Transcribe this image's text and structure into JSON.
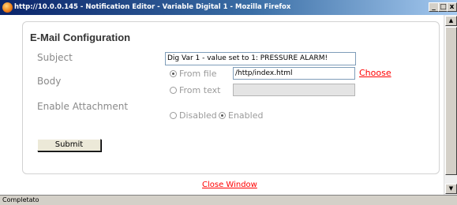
{
  "window": {
    "title": "http://10.0.0.145 - Notification Editor - Variable Digital 1 - Mozilla Firefox",
    "minimize_glyph": "_",
    "maximize_glyph": "□",
    "close_glyph": "x"
  },
  "form": {
    "section_title": "E-Mail Configuration",
    "subject_label": "Subject",
    "subject_value": "Dig Var 1 - value set to 1: PRESSURE ALARM!",
    "body_label": "Body",
    "from_file_label": "From file",
    "from_file_selected": true,
    "file_path_value": "/http/index.html",
    "choose_link": "Choose",
    "from_text_label": "From text",
    "text_value": "",
    "attachment_label": "Enable Attachment",
    "disabled_label": "Disabled",
    "enabled_label": "Enabled",
    "attachment_enabled": true,
    "submit_label": "Submit"
  },
  "footer": {
    "close_link": "Close Window"
  },
  "scroll": {
    "up_glyph": "▲",
    "down_glyph": "▼"
  },
  "status": {
    "text": "Completato"
  },
  "colors": {
    "link": "#ff0000",
    "titlebar_start": "#0a246a",
    "label_gray": "#8a8a8a"
  }
}
